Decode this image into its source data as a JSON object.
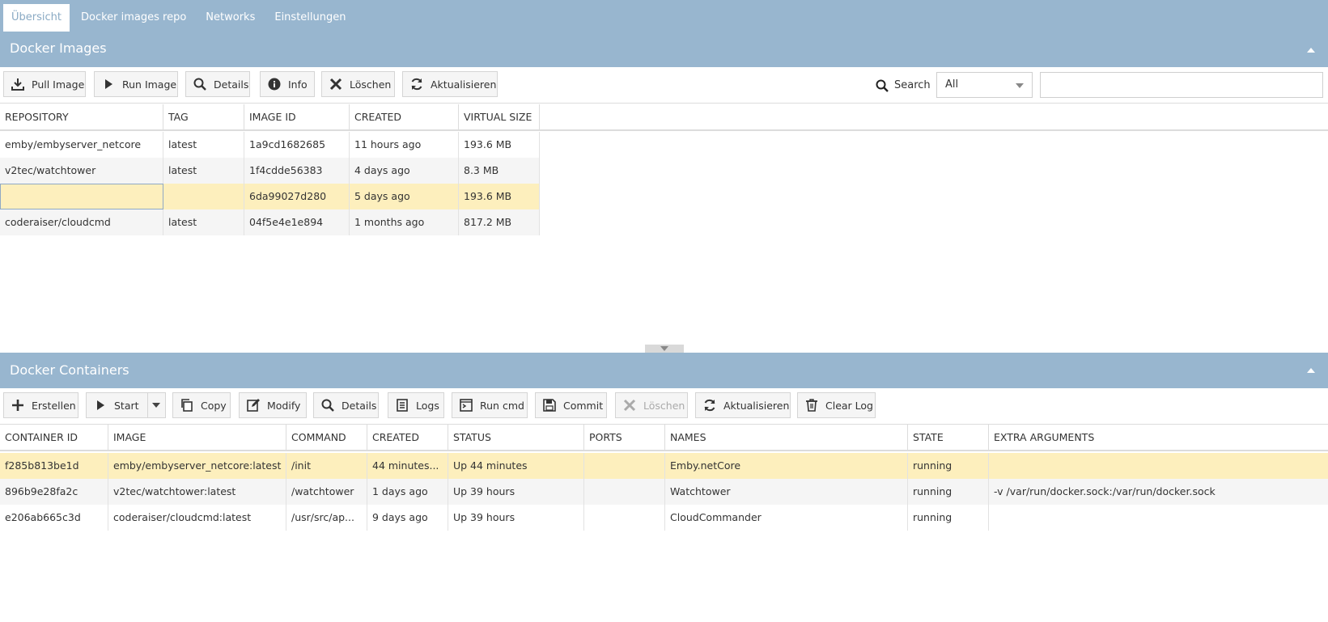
{
  "tabs": [
    {
      "label": "Übersicht",
      "active": true
    },
    {
      "label": "Docker images repo",
      "active": false
    },
    {
      "label": "Networks",
      "active": false
    },
    {
      "label": "Einstellungen",
      "active": false
    }
  ],
  "images_panel": {
    "title": "Docker Images",
    "toolbar": {
      "pull": "Pull Image",
      "run": "Run Image",
      "details": "Details",
      "info": "Info",
      "delete": "Löschen",
      "refresh": "Aktualisieren"
    },
    "search": {
      "label": "Search",
      "filter_value": "All",
      "query": ""
    },
    "columns": [
      "REPOSITORY",
      "TAG",
      "IMAGE ID",
      "CREATED",
      "VIRTUAL SIZE"
    ],
    "rows": [
      {
        "repository": "emby/embyserver_netcore",
        "tag": "latest",
        "image_id": "1a9cd1682685",
        "created": "11 hours ago",
        "size": "193.6 MB"
      },
      {
        "repository": "v2tec/watchtower",
        "tag": "latest",
        "image_id": "1f4cdde56383",
        "created": "4 days ago",
        "size": "8.3 MB"
      },
      {
        "repository": "",
        "tag": "",
        "image_id": "6da99027d280",
        "created": "5 days ago",
        "size": "193.6 MB"
      },
      {
        "repository": "coderaiser/cloudcmd",
        "tag": "latest",
        "image_id": "04f5e4e1e894",
        "created": "1 months ago",
        "size": "817.2 MB"
      }
    ]
  },
  "containers_panel": {
    "title": "Docker Containers",
    "toolbar": {
      "create": "Erstellen",
      "start": "Start",
      "copy": "Copy",
      "modify": "Modify",
      "details": "Details",
      "logs": "Logs",
      "run_cmd": "Run cmd",
      "commit": "Commit",
      "delete": "Löschen",
      "refresh": "Aktualisieren",
      "clear_log": "Clear Log"
    },
    "columns": [
      "CONTAINER ID",
      "IMAGE",
      "COMMAND",
      "CREATED",
      "STATUS",
      "PORTS",
      "NAMES",
      "STATE",
      "EXTRA ARGUMENTS"
    ],
    "rows": [
      {
        "id": "f285b813be1d",
        "image": "emby/embyserver_netcore:latest",
        "command": "/init",
        "created": "44 minutes...",
        "status": "Up 44 minutes",
        "ports": "",
        "names": "Emby.netCore",
        "state": "running",
        "extra": ""
      },
      {
        "id": "896b9e28fa2c",
        "image": "v2tec/watchtower:latest",
        "command": "/watchtower",
        "created": "1 days ago",
        "status": "Up 39 hours",
        "ports": "",
        "names": "Watchtower",
        "state": "running",
        "extra": "-v /var/run/docker.sock:/var/run/docker.sock"
      },
      {
        "id": "e206ab665c3d",
        "image": "coderaiser/cloudcmd:latest",
        "command": "/usr/src/ap...",
        "created": "9 days ago",
        "status": "Up 39 hours",
        "ports": "",
        "names": "CloudCommander",
        "state": "running",
        "extra": ""
      }
    ]
  },
  "colors": {
    "header_blue": "#98b6cf",
    "selected_row": "#fdefbd",
    "alt_row": "#f5f5f5"
  }
}
